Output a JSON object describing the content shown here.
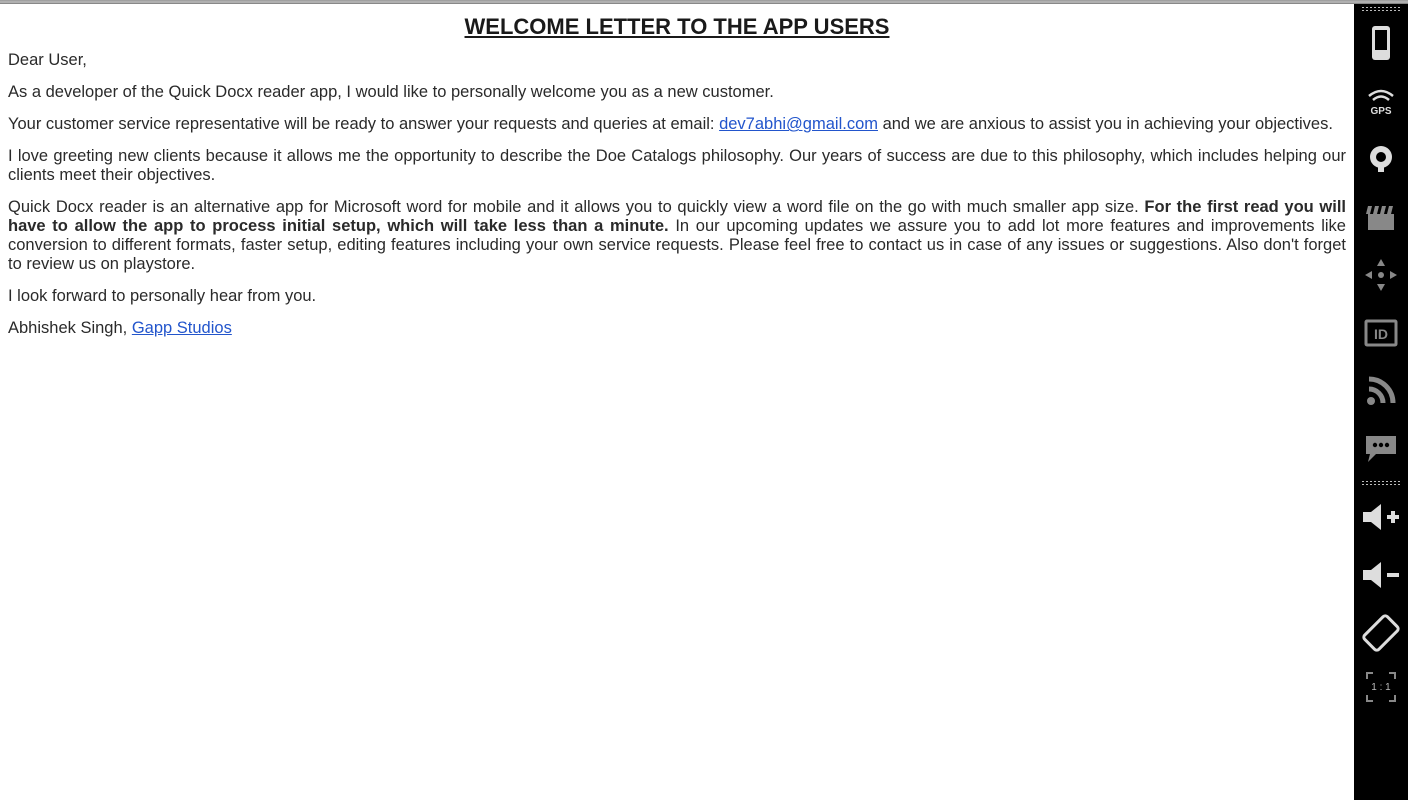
{
  "document": {
    "title": "WELCOME LETTER TO THE APP USERS",
    "greeting": "Dear User,",
    "p1": "As a developer of the Quick Docx reader app, I would like to personally welcome you as a new customer.",
    "p2_prefix": "Your customer service representative will be ready to answer your requests and queries at email: ",
    "email": "dev7abhi@gmail.com",
    "p2_suffix": " and we are anxious to assist you in achieving your objectives.",
    "p3": "I love greeting new clients because it allows me the opportunity to describe the Doe Catalogs philosophy. Our years of success are due to this philosophy, which includes helping our clients meet their objectives.",
    "p4_prefix": "Quick Docx reader is an alternative app for Microsoft word for mobile and it allows you to quickly view a word file on the go with much smaller app size. ",
    "p4_bold": "For the first read you will have to allow the app to process initial setup, which will take less than a minute.",
    "p4_suffix": " In our upcoming updates we assure you to add lot more features and improvements like conversion to different formats, faster setup, editing features including your own service requests. Please feel free to contact us in case of any issues or suggestions. Also don't forget to review us on playstore.",
    "p5": "I look forward to personally hear from you.",
    "sign_prefix": "Abhishek Singh, ",
    "sign_link": "Gapp Studios"
  },
  "sidebar": {
    "zoom_ratio": "1 : 1"
  }
}
